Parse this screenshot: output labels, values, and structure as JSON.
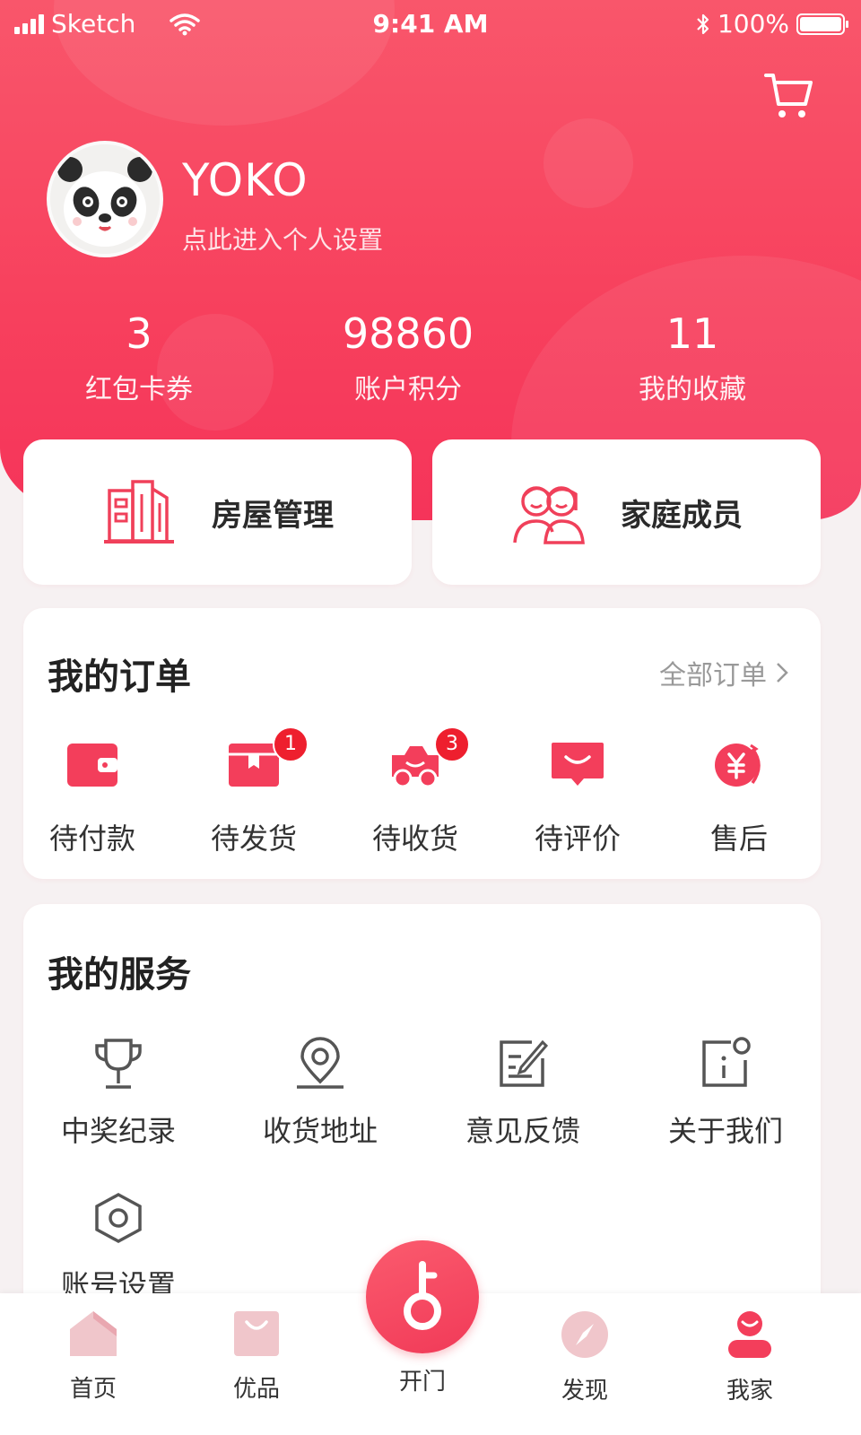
{
  "status_bar": {
    "carrier": "Sketch",
    "time": "9:41 AM",
    "battery": "100%"
  },
  "profile": {
    "username": "YOKO",
    "subtitle": "点此进入个人设置"
  },
  "stats": [
    {
      "value": "3",
      "label": "红包卡券"
    },
    {
      "value": "98860",
      "label": "账户积分"
    },
    {
      "value": "11",
      "label": "我的收藏"
    }
  ],
  "quick_actions": [
    {
      "label": "房屋管理",
      "icon": "building-icon"
    },
    {
      "label": "家庭成员",
      "icon": "family-icon"
    }
  ],
  "orders": {
    "title": "我的订单",
    "all_link": "全部订单",
    "items": [
      {
        "label": "待付款",
        "icon": "wallet-icon",
        "badge": ""
      },
      {
        "label": "待发货",
        "icon": "package-icon",
        "badge": "1"
      },
      {
        "label": "待收货",
        "icon": "delivery-truck-icon",
        "badge": "3"
      },
      {
        "label": "待评价",
        "icon": "comment-icon",
        "badge": ""
      },
      {
        "label": "售后",
        "icon": "refund-yen-icon",
        "badge": ""
      }
    ]
  },
  "services": {
    "title": "我的服务",
    "items": [
      {
        "label": "中奖纪录",
        "icon": "trophy-icon"
      },
      {
        "label": "收货地址",
        "icon": "location-pin-icon"
      },
      {
        "label": "意见反馈",
        "icon": "feedback-edit-icon"
      },
      {
        "label": "关于我们",
        "icon": "info-icon"
      },
      {
        "label": "账号设置",
        "icon": "settings-hexagon-icon"
      }
    ]
  },
  "tabbar": {
    "items": [
      {
        "label": "首页",
        "icon": "home-icon"
      },
      {
        "label": "优品",
        "icon": "shopping-bag-icon"
      },
      {
        "label": "开门",
        "icon": "key-icon"
      },
      {
        "label": "发现",
        "icon": "compass-icon"
      },
      {
        "label": "我家",
        "icon": "profile-icon"
      }
    ],
    "active": "我家"
  },
  "colors": {
    "primary": "#f7405d",
    "badge": "#ee1f2e",
    "background": "#f6f1f2"
  }
}
